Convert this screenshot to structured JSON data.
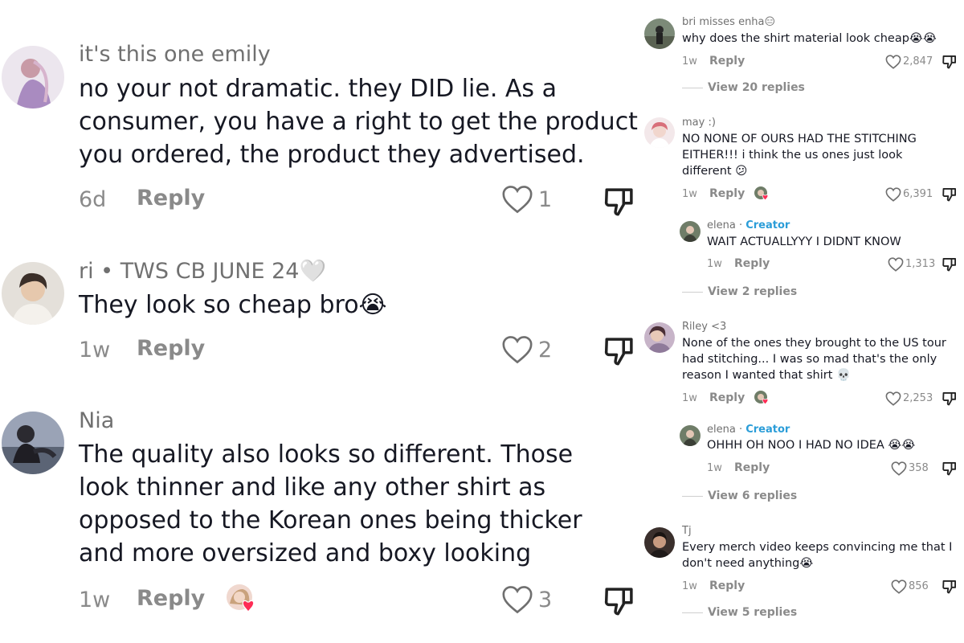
{
  "left_comments": [
    {
      "username": "it's this one emily",
      "lines": [
        "no your not dramatic. they DID lie. As a",
        "consumer, you have a right to get the product",
        "you ordered, the product they advertised."
      ],
      "time": "6d",
      "reply_label": "Reply",
      "likes": "1"
    },
    {
      "username": "ri • TWS CB JUNE 24🤍",
      "lines": [
        "They look so cheap bro😭"
      ],
      "time": "1w",
      "reply_label": "Reply",
      "likes": "2"
    },
    {
      "username": "Nia",
      "lines": [
        "The quality also looks so different. Those",
        "look thinner and like any other shirt as",
        "opposed to the Korean ones being thicker",
        "and more oversized and boxy looking"
      ],
      "time": "1w",
      "reply_label": "Reply",
      "likes": "3"
    }
  ],
  "right_comments": [
    {
      "username": "bri misses enha😑",
      "lines": [
        "why does the shirt material look cheap😭😭"
      ],
      "time": "1w",
      "reply_label": "Reply",
      "likes": "2,847",
      "view_replies": "View 20 replies"
    },
    {
      "username": "may :)",
      "lines": [
        "NO NONE OF OURS HAD THE STITCHING",
        "EITHER!!! i think the us ones just look",
        "different 😕"
      ],
      "time": "1w",
      "reply_label": "Reply",
      "likes": "6,391"
    },
    {
      "username": "elena",
      "creator_label": "Creator",
      "lines": [
        "WAIT ACTUALLYYY I DIDNT KNOW"
      ],
      "time": "1w",
      "reply_label": "Reply",
      "likes": "1,313",
      "view_replies": "View 2 replies"
    },
    {
      "username": "Riley <3",
      "lines": [
        "None of the ones they brought to the US tour",
        "had stitching... I was so mad that's the only",
        "reason I wanted that shirt 💀"
      ],
      "time": "1w",
      "reply_label": "Reply",
      "likes": "2,253"
    },
    {
      "username": "elena",
      "creator_label": "Creator",
      "lines": [
        "OHHH OH NOO I HAD NO IDEA 😭😭"
      ],
      "time": "1w",
      "reply_label": "Reply",
      "likes": "358",
      "view_replies": "View 6 replies"
    },
    {
      "username": "Tj",
      "lines": [
        "Every merch video keeps convincing me that I",
        "don't need anything😭"
      ],
      "time": "1w",
      "reply_label": "Reply",
      "likes": "856",
      "view_replies": "View 5 replies"
    }
  ],
  "colors": {
    "text": "#161823",
    "muted": "#8a8a8a",
    "creator": "#2b9dd8",
    "like_heart": "#fe2c55"
  },
  "icons": {
    "like": "heart-outline-icon",
    "dislike": "thumbs-down-icon",
    "creator_liked": "creator-liked-avatar-icon"
  }
}
